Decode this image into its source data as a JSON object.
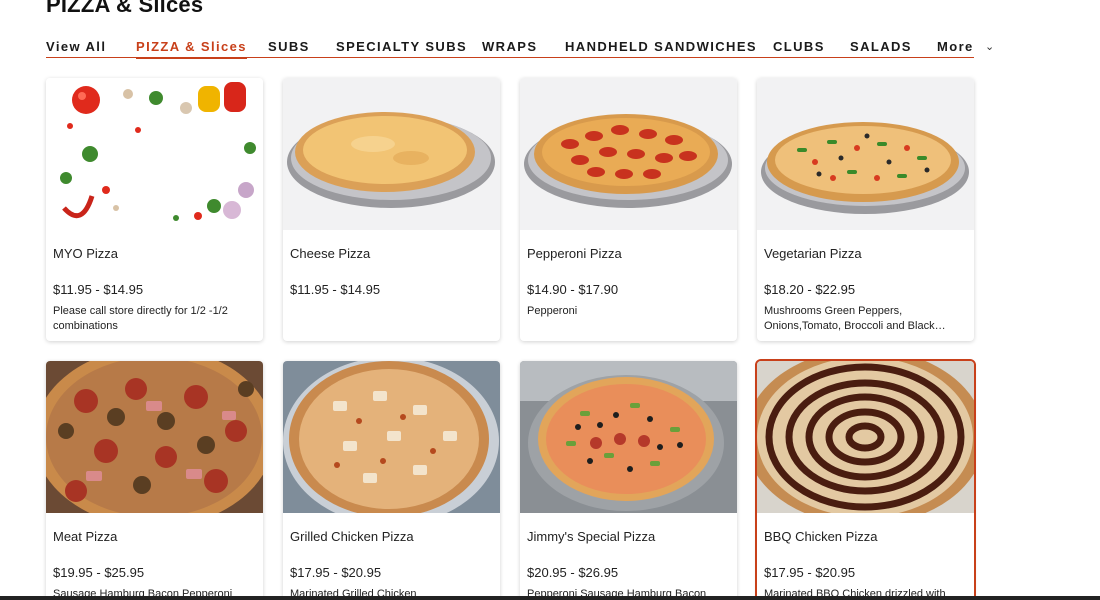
{
  "page": {
    "title": "PIZZA & Slices"
  },
  "nav": {
    "tabs": [
      {
        "label": "View All",
        "active": false
      },
      {
        "label": "PIZZA & Slices",
        "active": true
      },
      {
        "label": "SUBS",
        "active": false
      },
      {
        "label": "SPECIALTY SUBS",
        "active": false
      },
      {
        "label": "WRAPS",
        "active": false
      },
      {
        "label": "HANDHELD SANDWICHES",
        "active": false
      },
      {
        "label": "CLUBS",
        "active": false
      },
      {
        "label": "SALADS",
        "active": false
      },
      {
        "label": "More",
        "active": false
      }
    ],
    "more_icon": "chevron-down-icon"
  },
  "colors": {
    "accent": "#c8401a",
    "text": "#1a1a1a"
  },
  "items": [
    {
      "name": "MYO Pizza",
      "price": "$11.95 - $14.95",
      "desc": "Please call store directly for 1/2 -1/2 combinations",
      "image": "ingredients"
    },
    {
      "name": "Cheese Pizza",
      "price": "$11.95 - $14.95",
      "desc": "",
      "image": "cheese"
    },
    {
      "name": "Pepperoni Pizza",
      "price": "$14.90 - $17.90",
      "desc": "Pepperoni",
      "image": "pepperoni"
    },
    {
      "name": "Vegetarian Pizza",
      "price": "$18.20 - $22.95",
      "desc": "Mushrooms Green Peppers, Onions,Tomato, Broccoli and Black…",
      "image": "vegetarian"
    },
    {
      "name": "Meat Pizza",
      "price": "$19.95 - $25.95",
      "desc": "Sausage Hamburg Bacon Pepperoni and",
      "image": "meat"
    },
    {
      "name": "Grilled Chicken Pizza",
      "price": "$17.95 - $20.95",
      "desc": "Marinated Grilled Chicken",
      "image": "chicken"
    },
    {
      "name": "Jimmy's Special Pizza",
      "price": "$20.95 - $26.95",
      "desc": "Pepperoni Sausage Hamburg Bacon Salami Ham",
      "image": "special"
    },
    {
      "name": "BBQ Chicken Pizza",
      "price": "$17.95 - $20.95",
      "desc": "Marinated BBQ Chicken drizzled with",
      "image": "bbq",
      "selected": true
    }
  ]
}
